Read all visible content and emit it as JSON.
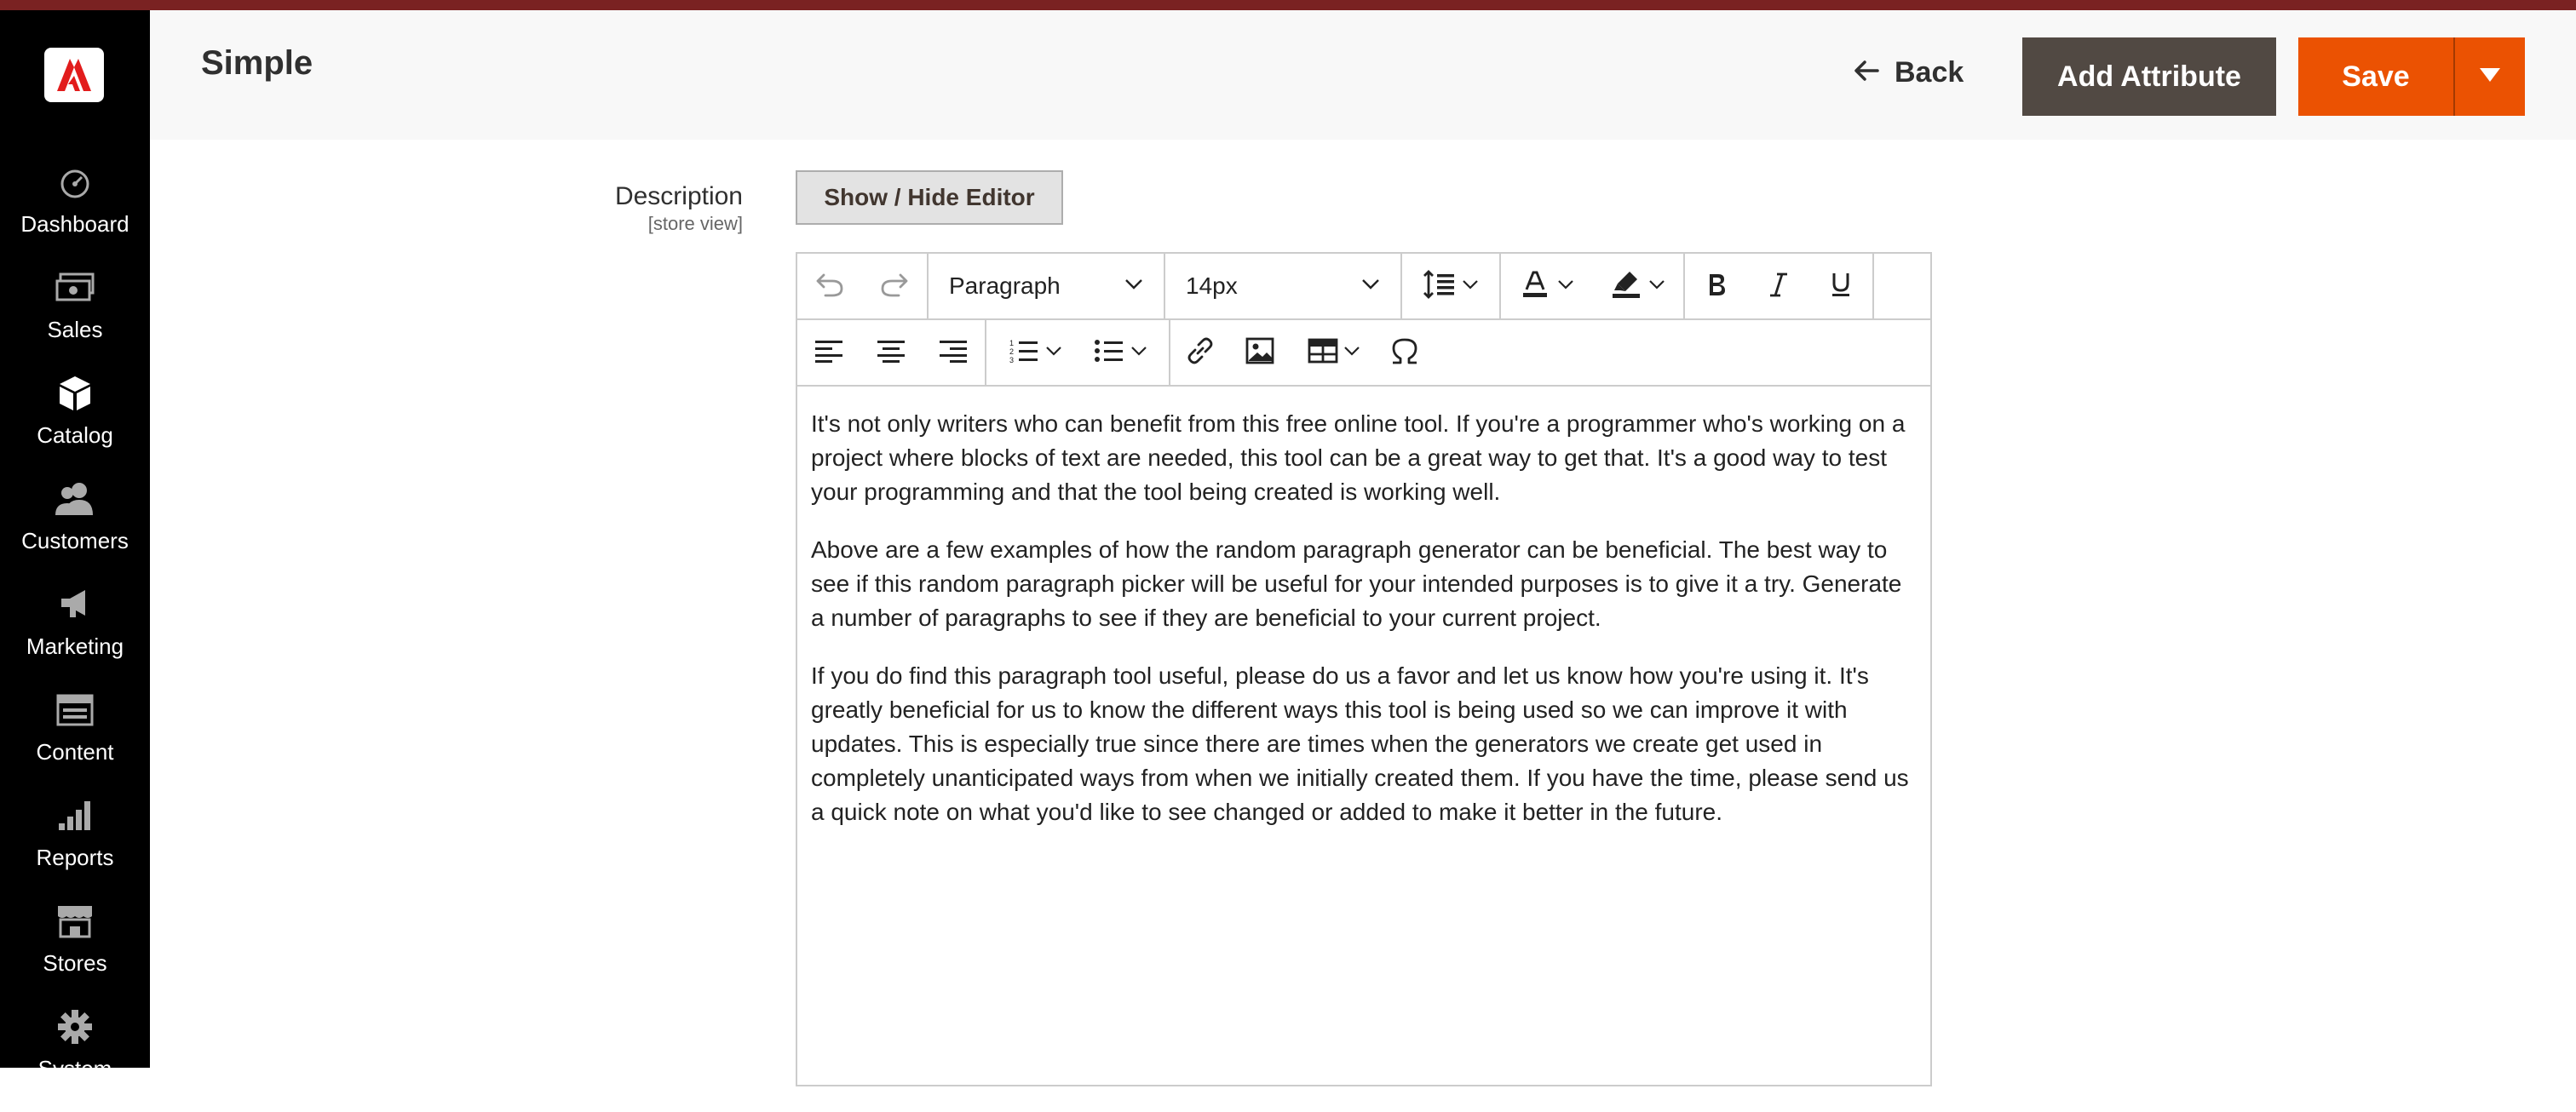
{
  "colors": {
    "sidebar_bg": "#000000",
    "accent_orange": "#eb5202",
    "dark_button": "#514943",
    "top_strip": "#7a2222"
  },
  "sidebar": {
    "logo_icon": "adobe-logo-icon",
    "items": [
      {
        "label": "Dashboard",
        "icon": "dashboard-gauge-icon"
      },
      {
        "label": "Sales",
        "icon": "sales-money-icon"
      },
      {
        "label": "Catalog",
        "icon": "catalog-box-icon"
      },
      {
        "label": "Customers",
        "icon": "customers-people-icon"
      },
      {
        "label": "Marketing",
        "icon": "marketing-megaphone-icon"
      },
      {
        "label": "Content",
        "icon": "content-layout-icon"
      },
      {
        "label": "Reports",
        "icon": "reports-bars-icon"
      },
      {
        "label": "Stores",
        "icon": "stores-shop-icon"
      },
      {
        "label": "System",
        "icon": "system-gear-icon"
      }
    ]
  },
  "header": {
    "title": "Simple",
    "back_label": "Back",
    "add_attribute_label": "Add Attribute",
    "save_label": "Save"
  },
  "form": {
    "description_label": "Description",
    "description_scope": "[store view]",
    "toggle_editor_label": "Show / Hide Editor"
  },
  "editor": {
    "block_format": "Paragraph",
    "font_size": "14px",
    "paragraphs": [
      "It's not only writers who can benefit from this free online tool. If you're a programmer who's working on a project where blocks of text are needed, this tool can be a great way to get that. It's a good way to test your programming and that the tool being created is working well.",
      "Above are a few examples of how the random paragraph generator can be beneficial. The best way to see if this random paragraph picker will be useful for your intended purposes is to give it a try. Generate a number of paragraphs to see if they are beneficial to your current project.",
      "If you do find this paragraph tool useful, please do us a favor and let us know how you're using it. It's greatly beneficial for us to know the different ways this tool is being used so we can improve it with updates. This is especially true since there are times when the generators we create get used in completely unanticipated ways from when we initially created them. If you have the time, please send us a quick note on what you'd like to see changed or added to make it better in the future."
    ]
  }
}
